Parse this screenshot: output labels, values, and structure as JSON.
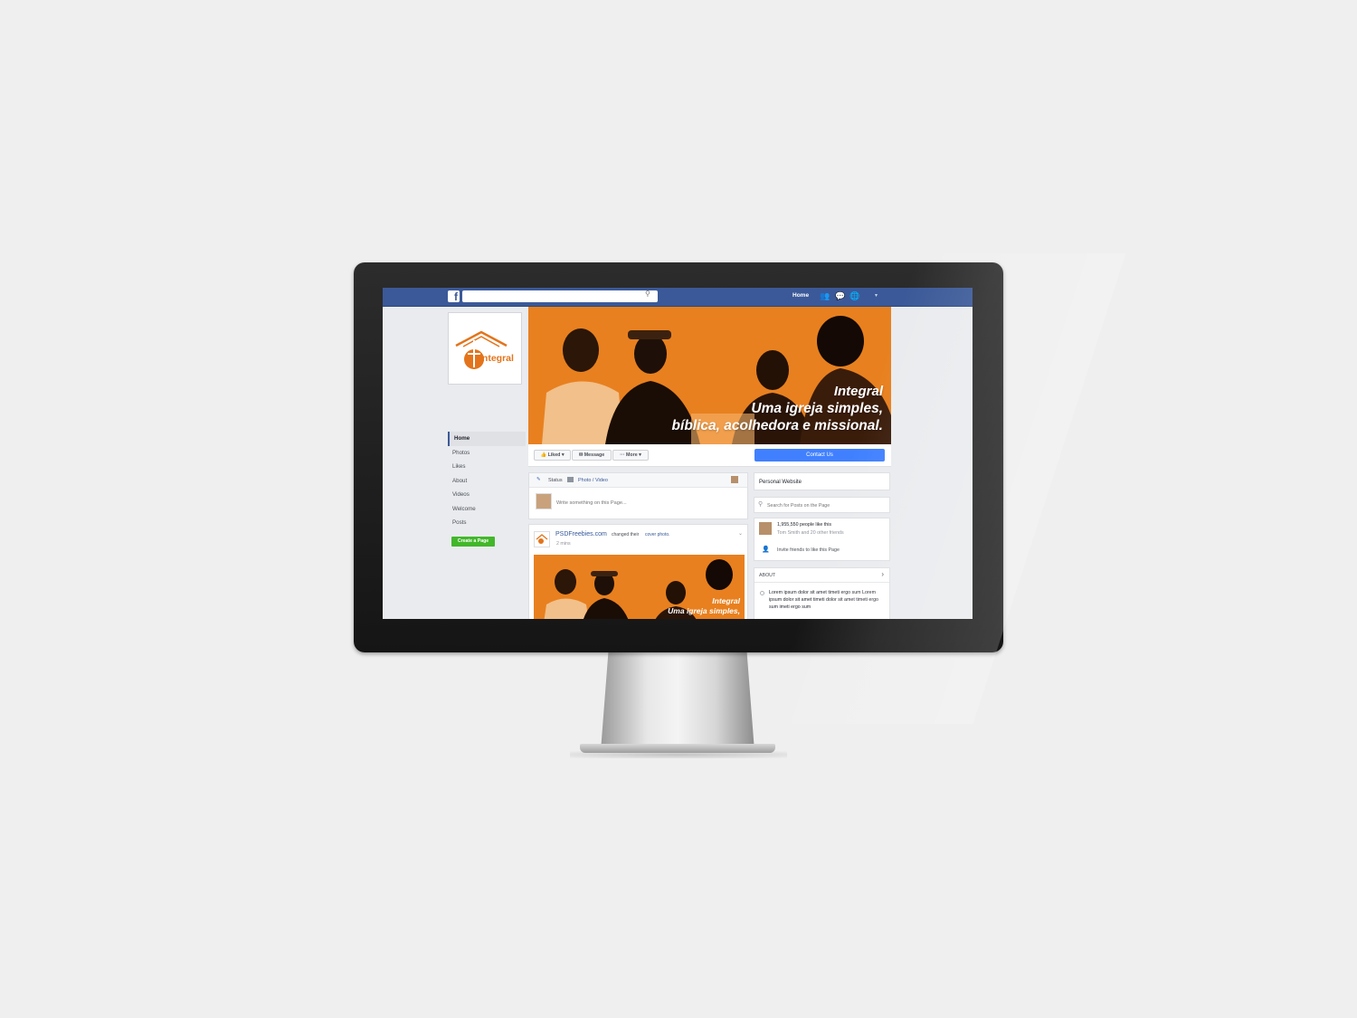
{
  "topbar": {
    "logo": "f",
    "search_placeholder": "",
    "home_label": "Home",
    "account_label": "▾"
  },
  "profile": {
    "logo_text": "integral"
  },
  "sidebar": {
    "items": [
      {
        "label": "Home"
      },
      {
        "label": "Photos"
      },
      {
        "label": "Likes"
      },
      {
        "label": "About"
      },
      {
        "label": "Videos"
      },
      {
        "label": "Welcome"
      },
      {
        "label": "Posts"
      }
    ],
    "create_page": "Create a Page"
  },
  "cover": {
    "line1": "Integral",
    "line2": "Uma igreja simples,",
    "line3": "bíblica, acolhedora e missional."
  },
  "actions": {
    "liked": "Liked ▾",
    "message": "Message",
    "more": "··· More ▾",
    "contact": "Contact Us"
  },
  "composer": {
    "status": "Status",
    "photo_video": "Photo / Video",
    "placeholder": "Write something on this Page..."
  },
  "post": {
    "author": "PSDFreebies.com",
    "action_text": "changed their",
    "action_link": "cover photo.",
    "time": "2 mins",
    "photo_line1": "Integral",
    "photo_line2": "Uma igreja simples,"
  },
  "right_column": {
    "website": "Personal Website",
    "search_placeholder": "Search for Posts on the Page",
    "likes_count": "1,955,550 people like this",
    "friends_like": "Tom Smith and 20 other friends",
    "invite": "Invite friends to like this Page",
    "about_header": "ABOUT",
    "about_text": "Lorem ipsum dolor sit amet timeti ergo sum Lorem ipsum dolor sit amet timeti dolor sit amet timeti ergo sum imeti ergo sum"
  },
  "colors": {
    "fb_blue": "#3b5998",
    "orange": "#e8801f",
    "contact_blue": "#4080ff",
    "green": "#42b72a"
  }
}
